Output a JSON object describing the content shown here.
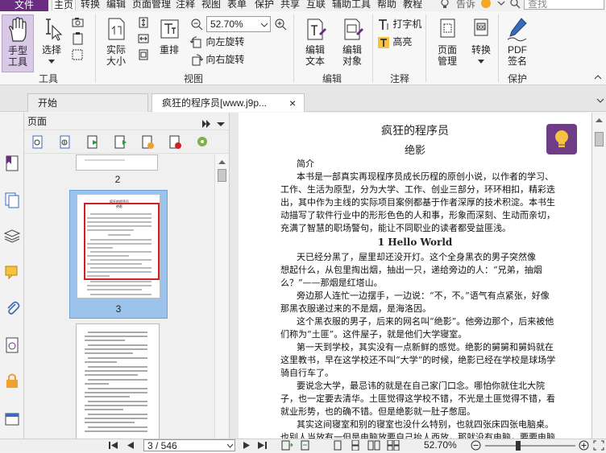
{
  "menu": {
    "file": "文件",
    "items": [
      "主页",
      "转换",
      "编辑",
      "页面管理",
      "注释",
      "视图",
      "表单",
      "保护",
      "共享",
      "互联",
      "辅助工具",
      "帮助",
      "教程"
    ],
    "active": "主页",
    "tell_me": "告诉",
    "search_placeholder": "查找"
  },
  "ribbon": {
    "groups": {
      "tools": "工具",
      "view": "视图",
      "edit": "编辑",
      "comment": "注释",
      "protect": "保护"
    },
    "hand_tool": [
      "手型",
      "工具"
    ],
    "select": "选择",
    "actual_size": [
      "实际",
      "大小"
    ],
    "reflow": "重排",
    "zoom_value": "52.70%",
    "rotate_left": "向左旋转",
    "rotate_right": "向右旋转",
    "edit_text": [
      "编辑",
      "文本"
    ],
    "edit_object": [
      "编辑",
      "对象"
    ],
    "typewriter": "打字机",
    "highlight": "高亮",
    "page_manage": [
      "页面",
      "管理"
    ],
    "convert": "转换",
    "pdf_sign": [
      "PDF",
      "签名"
    ]
  },
  "tabs": {
    "start": "开始",
    "doc": "疯狂的程序员[www.j9p...",
    "close_glyph": "×"
  },
  "panel": {
    "title": "页面",
    "thumb_labels": [
      "2",
      "3"
    ],
    "thumb3_title": "疯狂的程序员",
    "thumb3_sub": "绝影"
  },
  "document": {
    "title": "疯狂的程序员",
    "subtitle": "绝影",
    "intro": "简介",
    "lines": [
      "本书是一部真实再现程序员成长历程的原创小说，以作者的学习、",
      "工作、生活为原型，分为大学、工作、创业三部分，环环相扣，精彩迭",
      "出，其中作为主线的实际项目案例都基于作者深厚的技术积淀。本书生",
      "动描写了软件行业中的形形色色的人和事，形象而深刻、生动而亲切，",
      "充满了智慧的职场警句，能让不同职业的读者都受益匪浅。"
    ],
    "chapter": "1 Hello World",
    "para1": [
      "天已经分黑了，屋里却还没开灯。这个全身黑衣的男子突然像",
      "想起什么，从包里掏出烟，抽出一只，递给旁边的人：“兄弟，抽烟",
      "么？”——那烟是红塔山。"
    ],
    "para2": [
      "旁边那人连忙一边摆手，一边说：“不，不。”语气有点紧张，好像",
      "那黑衣服递过来的不是烟，是海洛因。"
    ],
    "para3": [
      "这个黑衣服的男子，后来的网名叫“绝影”。他旁边那个，后来被他",
      "们称为“土匪”。这件屋子，就是他们大学寝室。"
    ],
    "para4": [
      "第一天到学校，其实没有一点新鲜的感觉。绝影的舅舅和舅妈就在",
      "这里教书，早在这学校还不叫“大学”的时候，绝影已经在学校是球场学",
      "骑自行车了。"
    ],
    "para5": [
      "要说念大学，最忌讳的就是在自己家门口念。哪怕你就住北大院",
      "子，也一定要去清华。土匪觉得这学校不错，不光是土匪觉得不错，看",
      "就业形势，也的确不错。但是绝影就一肚子憋屈。"
    ],
    "para6": [
      "其实这间寝室和别的寝室也没什么特别，也就四张床四张电脑桌。",
      "也别人当放有一但是电脑放要自己抬人西放，那就没有电脑，要要电脑"
    ]
  },
  "status": {
    "page_field": "3 / 546",
    "zoom": "52.70%"
  },
  "colors": {
    "brand_purple": "#6b2d82",
    "thumb_selected_bg": "#9cc3ec",
    "highlight_red": "#d21f1f",
    "bulb_bg": "#6e3d86"
  }
}
